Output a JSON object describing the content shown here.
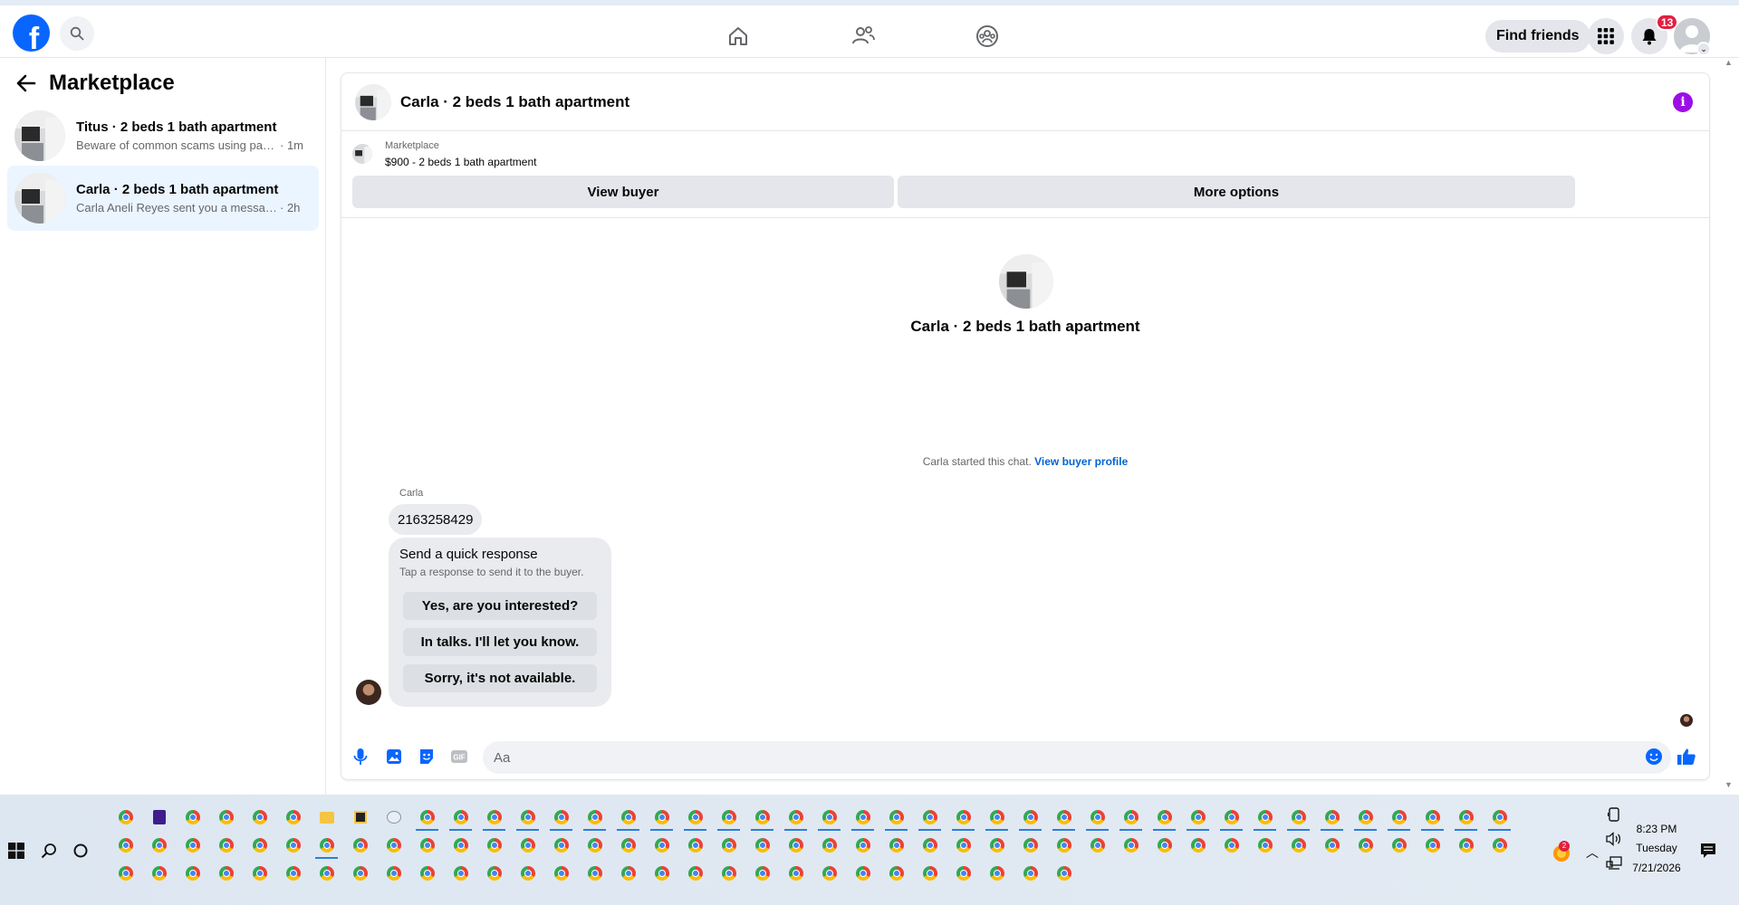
{
  "topbar": {
    "logo_letter": "f",
    "find_friends_label": "Find friends",
    "notification_count": "13",
    "accent_color": "#0866ff"
  },
  "left_panel": {
    "title": "Marketplace",
    "conversations": [
      {
        "title": "Titus · 2 beds 1 bath apartment",
        "snippet": "Beware of common scams using pay...",
        "time": "· 1m",
        "active": false
      },
      {
        "title": "Carla · 2 beds 1 bath apartment",
        "snippet": "Carla Aneli Reyes sent you a message ...",
        "time": "· 2h",
        "active": true
      }
    ]
  },
  "chat": {
    "header_title": "Carla · 2 beds 1 bath apartment",
    "listing_label": "Marketplace",
    "listing_name": "$900 - 2 beds 1 bath apartment",
    "view_buyer_label": "View buyer",
    "more_options_label": "More options",
    "center_title": "Carla · 2 beds 1 bath apartment",
    "started_text": "Carla started this chat.",
    "view_profile_link": "View buyer profile",
    "sender_name": "Carla",
    "message_text": "2163258429",
    "quick_response": {
      "title": "Send a quick response",
      "subtitle": "Tap a response to send it to the buyer.",
      "options": [
        "Yes, are you interested?",
        "In talks. I'll let you know.",
        "Sorry, it's not available."
      ]
    },
    "composer_placeholder": "Aa"
  },
  "taskbar": {
    "time": "8:23 PM",
    "day": "Tuesday",
    "date": "7/21/2026",
    "tray_badge": "2"
  }
}
